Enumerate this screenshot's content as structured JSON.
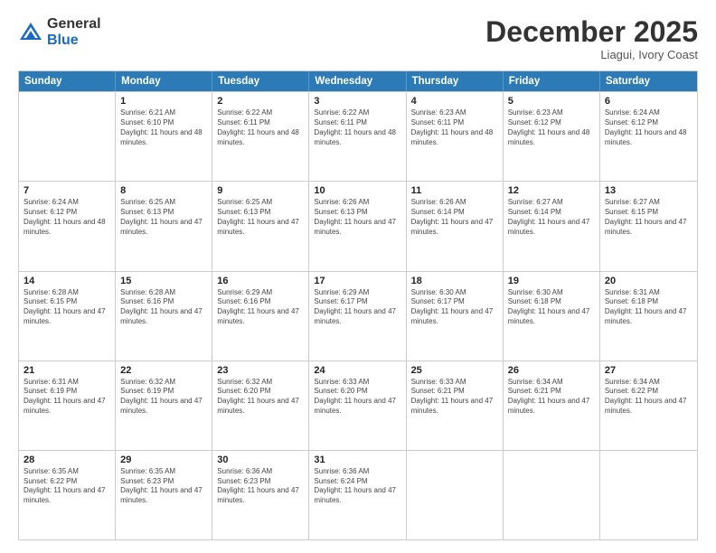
{
  "logo": {
    "general": "General",
    "blue": "Blue"
  },
  "header": {
    "month": "December 2025",
    "location": "Liagui, Ivory Coast"
  },
  "days_of_week": [
    "Sunday",
    "Monday",
    "Tuesday",
    "Wednesday",
    "Thursday",
    "Friday",
    "Saturday"
  ],
  "weeks": [
    [
      {
        "day": "",
        "sunrise": "",
        "sunset": "",
        "daylight": ""
      },
      {
        "day": "1",
        "sunrise": "Sunrise: 6:21 AM",
        "sunset": "Sunset: 6:10 PM",
        "daylight": "Daylight: 11 hours and 48 minutes."
      },
      {
        "day": "2",
        "sunrise": "Sunrise: 6:22 AM",
        "sunset": "Sunset: 6:11 PM",
        "daylight": "Daylight: 11 hours and 48 minutes."
      },
      {
        "day": "3",
        "sunrise": "Sunrise: 6:22 AM",
        "sunset": "Sunset: 6:11 PM",
        "daylight": "Daylight: 11 hours and 48 minutes."
      },
      {
        "day": "4",
        "sunrise": "Sunrise: 6:23 AM",
        "sunset": "Sunset: 6:11 PM",
        "daylight": "Daylight: 11 hours and 48 minutes."
      },
      {
        "day": "5",
        "sunrise": "Sunrise: 6:23 AM",
        "sunset": "Sunset: 6:12 PM",
        "daylight": "Daylight: 11 hours and 48 minutes."
      },
      {
        "day": "6",
        "sunrise": "Sunrise: 6:24 AM",
        "sunset": "Sunset: 6:12 PM",
        "daylight": "Daylight: 11 hours and 48 minutes."
      }
    ],
    [
      {
        "day": "7",
        "sunrise": "Sunrise: 6:24 AM",
        "sunset": "Sunset: 6:12 PM",
        "daylight": "Daylight: 11 hours and 48 minutes."
      },
      {
        "day": "8",
        "sunrise": "Sunrise: 6:25 AM",
        "sunset": "Sunset: 6:13 PM",
        "daylight": "Daylight: 11 hours and 47 minutes."
      },
      {
        "day": "9",
        "sunrise": "Sunrise: 6:25 AM",
        "sunset": "Sunset: 6:13 PM",
        "daylight": "Daylight: 11 hours and 47 minutes."
      },
      {
        "day": "10",
        "sunrise": "Sunrise: 6:26 AM",
        "sunset": "Sunset: 6:13 PM",
        "daylight": "Daylight: 11 hours and 47 minutes."
      },
      {
        "day": "11",
        "sunrise": "Sunrise: 6:26 AM",
        "sunset": "Sunset: 6:14 PM",
        "daylight": "Daylight: 11 hours and 47 minutes."
      },
      {
        "day": "12",
        "sunrise": "Sunrise: 6:27 AM",
        "sunset": "Sunset: 6:14 PM",
        "daylight": "Daylight: 11 hours and 47 minutes."
      },
      {
        "day": "13",
        "sunrise": "Sunrise: 6:27 AM",
        "sunset": "Sunset: 6:15 PM",
        "daylight": "Daylight: 11 hours and 47 minutes."
      }
    ],
    [
      {
        "day": "14",
        "sunrise": "Sunrise: 6:28 AM",
        "sunset": "Sunset: 6:15 PM",
        "daylight": "Daylight: 11 hours and 47 minutes."
      },
      {
        "day": "15",
        "sunrise": "Sunrise: 6:28 AM",
        "sunset": "Sunset: 6:16 PM",
        "daylight": "Daylight: 11 hours and 47 minutes."
      },
      {
        "day": "16",
        "sunrise": "Sunrise: 6:29 AM",
        "sunset": "Sunset: 6:16 PM",
        "daylight": "Daylight: 11 hours and 47 minutes."
      },
      {
        "day": "17",
        "sunrise": "Sunrise: 6:29 AM",
        "sunset": "Sunset: 6:17 PM",
        "daylight": "Daylight: 11 hours and 47 minutes."
      },
      {
        "day": "18",
        "sunrise": "Sunrise: 6:30 AM",
        "sunset": "Sunset: 6:17 PM",
        "daylight": "Daylight: 11 hours and 47 minutes."
      },
      {
        "day": "19",
        "sunrise": "Sunrise: 6:30 AM",
        "sunset": "Sunset: 6:18 PM",
        "daylight": "Daylight: 11 hours and 47 minutes."
      },
      {
        "day": "20",
        "sunrise": "Sunrise: 6:31 AM",
        "sunset": "Sunset: 6:18 PM",
        "daylight": "Daylight: 11 hours and 47 minutes."
      }
    ],
    [
      {
        "day": "21",
        "sunrise": "Sunrise: 6:31 AM",
        "sunset": "Sunset: 6:19 PM",
        "daylight": "Daylight: 11 hours and 47 minutes."
      },
      {
        "day": "22",
        "sunrise": "Sunrise: 6:32 AM",
        "sunset": "Sunset: 6:19 PM",
        "daylight": "Daylight: 11 hours and 47 minutes."
      },
      {
        "day": "23",
        "sunrise": "Sunrise: 6:32 AM",
        "sunset": "Sunset: 6:20 PM",
        "daylight": "Daylight: 11 hours and 47 minutes."
      },
      {
        "day": "24",
        "sunrise": "Sunrise: 6:33 AM",
        "sunset": "Sunset: 6:20 PM",
        "daylight": "Daylight: 11 hours and 47 minutes."
      },
      {
        "day": "25",
        "sunrise": "Sunrise: 6:33 AM",
        "sunset": "Sunset: 6:21 PM",
        "daylight": "Daylight: 11 hours and 47 minutes."
      },
      {
        "day": "26",
        "sunrise": "Sunrise: 6:34 AM",
        "sunset": "Sunset: 6:21 PM",
        "daylight": "Daylight: 11 hours and 47 minutes."
      },
      {
        "day": "27",
        "sunrise": "Sunrise: 6:34 AM",
        "sunset": "Sunset: 6:22 PM",
        "daylight": "Daylight: 11 hours and 47 minutes."
      }
    ],
    [
      {
        "day": "28",
        "sunrise": "Sunrise: 6:35 AM",
        "sunset": "Sunset: 6:22 PM",
        "daylight": "Daylight: 11 hours and 47 minutes."
      },
      {
        "day": "29",
        "sunrise": "Sunrise: 6:35 AM",
        "sunset": "Sunset: 6:23 PM",
        "daylight": "Daylight: 11 hours and 47 minutes."
      },
      {
        "day": "30",
        "sunrise": "Sunrise: 6:36 AM",
        "sunset": "Sunset: 6:23 PM",
        "daylight": "Daylight: 11 hours and 47 minutes."
      },
      {
        "day": "31",
        "sunrise": "Sunrise: 6:36 AM",
        "sunset": "Sunset: 6:24 PM",
        "daylight": "Daylight: 11 hours and 47 minutes."
      },
      {
        "day": "",
        "sunrise": "",
        "sunset": "",
        "daylight": ""
      },
      {
        "day": "",
        "sunrise": "",
        "sunset": "",
        "daylight": ""
      },
      {
        "day": "",
        "sunrise": "",
        "sunset": "",
        "daylight": ""
      }
    ]
  ]
}
